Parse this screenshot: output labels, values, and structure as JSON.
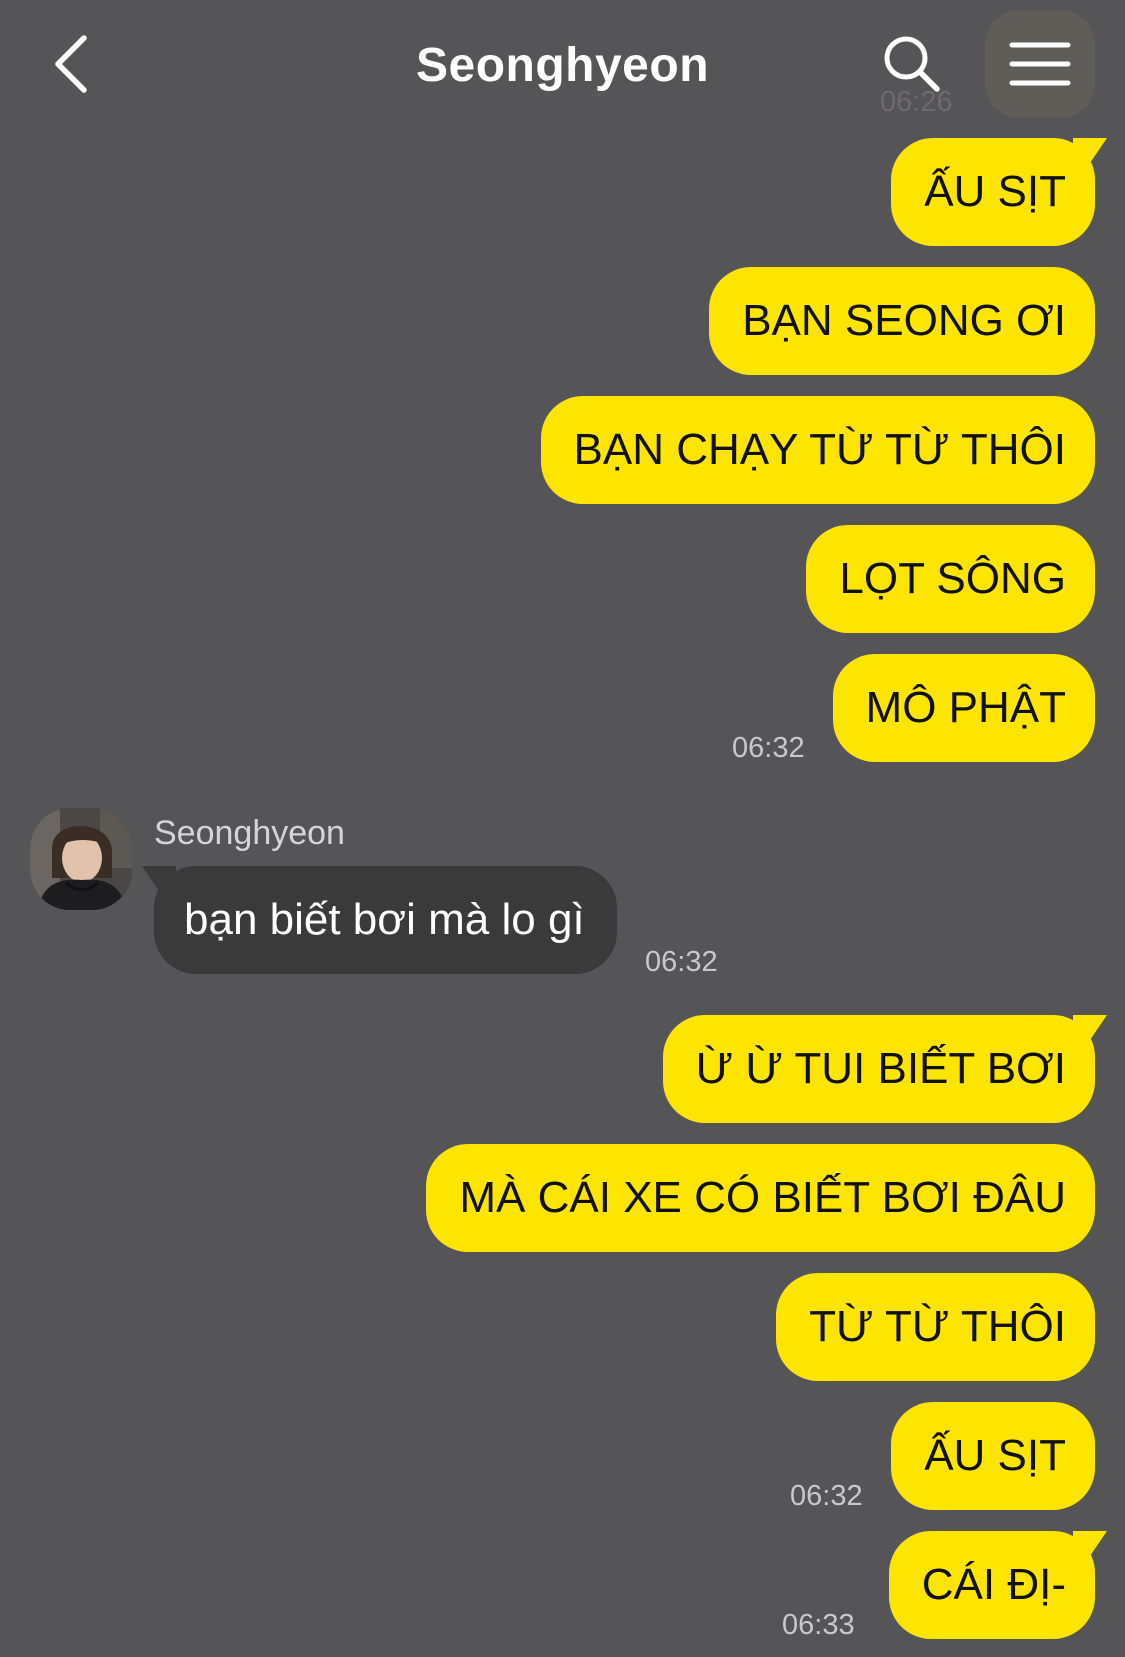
{
  "header": {
    "title": "Seonghyeon",
    "back_icon": "chevron-left-icon",
    "search_icon": "search-icon",
    "menu_icon": "hamburger-menu-icon",
    "faded_time": "06:26"
  },
  "colors": {
    "background": "#555456",
    "outgoing_bubble": "#fee500",
    "incoming_bubble": "#3b3a3b"
  },
  "messages_group_1": [
    {
      "text": "ẤU SỊT"
    },
    {
      "text": "BẠN SEONG ƠI"
    },
    {
      "text": "BẠN CHẠY TỪ TỪ THÔI"
    },
    {
      "text": "LỌT SÔNG"
    },
    {
      "text": "MÔ PHẬT"
    }
  ],
  "time_group_1": "06:32",
  "incoming": {
    "sender": "Seonghyeon",
    "text": "bạn biết bơi mà lo gì",
    "time": "06:32"
  },
  "messages_group_2": [
    {
      "text": "Ừ Ừ TUI BIẾT BƠI"
    },
    {
      "text": "MÀ CÁI XE CÓ BIẾT BƠI ĐÂU"
    },
    {
      "text": "TỪ TỪ THÔI"
    },
    {
      "text": "ẤU SỊT"
    }
  ],
  "time_group_2": "06:32",
  "messages_group_3": [
    {
      "text": "CÁI ĐỊ-"
    }
  ],
  "time_group_3": "06:33"
}
